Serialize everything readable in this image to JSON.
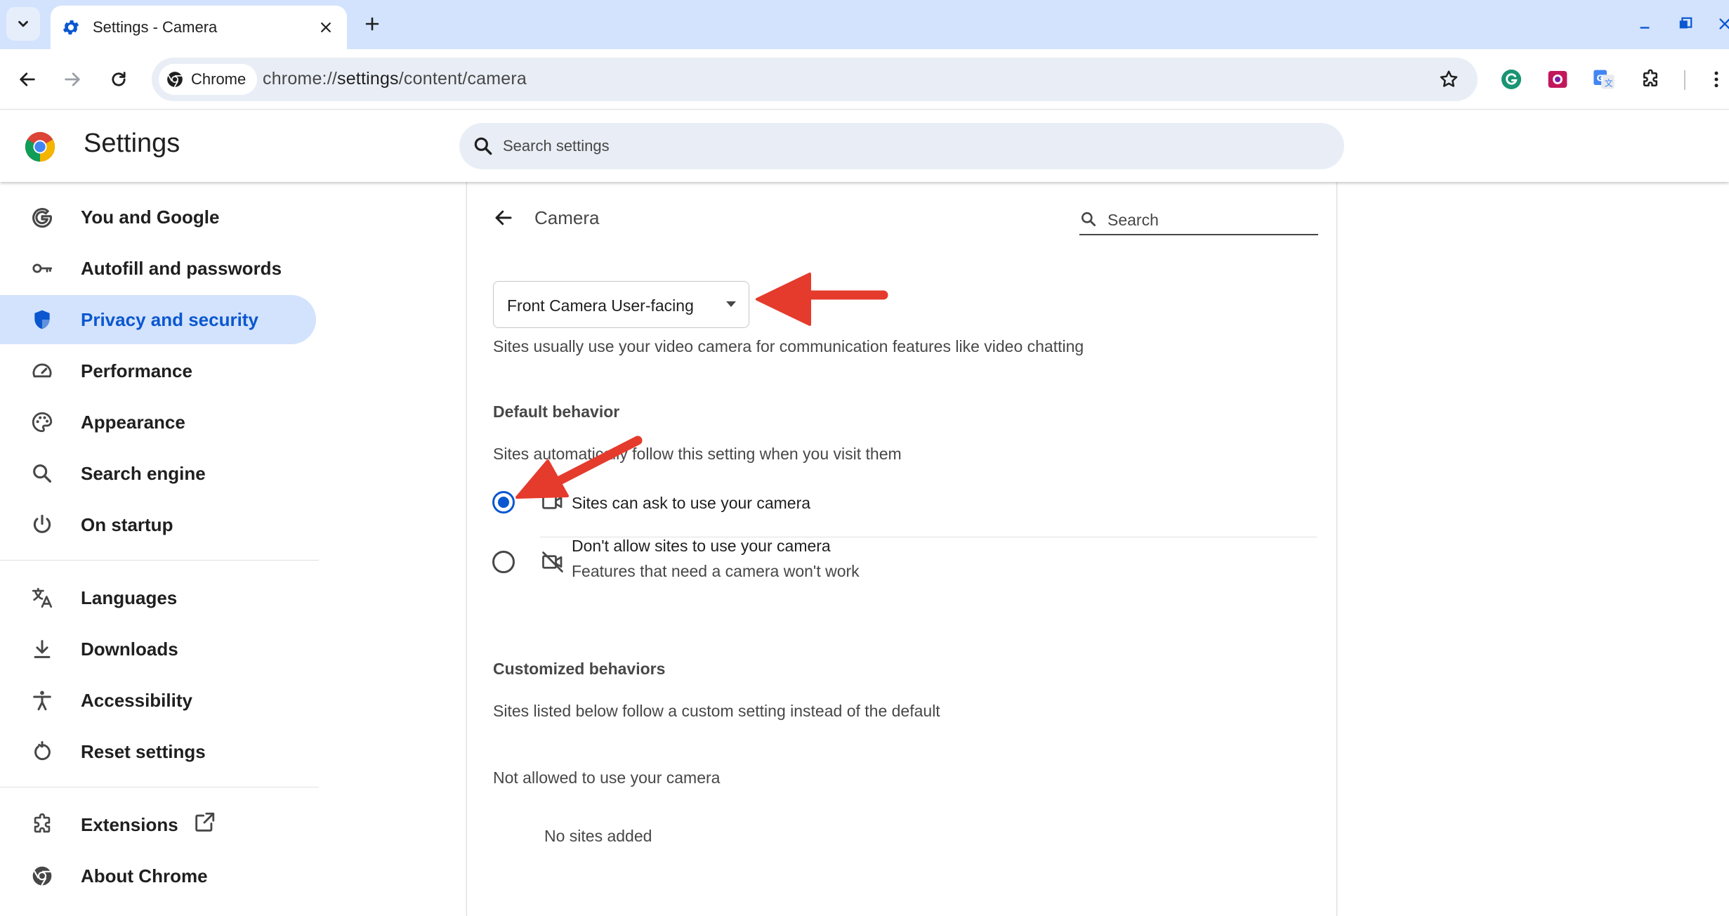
{
  "browser": {
    "tab": {
      "title": "Settings - Camera",
      "icon": "gear-icon"
    },
    "chip_label": "Chrome",
    "url": {
      "scheme": "chrome://",
      "host": "settings",
      "path": "/content/camera"
    }
  },
  "header": {
    "title": "Settings",
    "search_placeholder": "Search settings"
  },
  "sidebar": {
    "items": [
      {
        "label": "You and Google",
        "icon": "google-g-icon"
      },
      {
        "label": "Autofill and passwords",
        "icon": "key-icon"
      },
      {
        "label": "Privacy and security",
        "icon": "shield-icon",
        "active": true
      },
      {
        "label": "Performance",
        "icon": "speedometer-icon"
      },
      {
        "label": "Appearance",
        "icon": "palette-icon"
      },
      {
        "label": "Search engine",
        "icon": "search-icon"
      },
      {
        "label": "On startup",
        "icon": "power-icon"
      },
      {
        "label": "Languages",
        "icon": "translate-icon"
      },
      {
        "label": "Downloads",
        "icon": "download-icon"
      },
      {
        "label": "Accessibility",
        "icon": "accessibility-icon"
      },
      {
        "label": "Reset settings",
        "icon": "reset-icon"
      },
      {
        "label": "Extensions",
        "icon": "puzzle-icon"
      },
      {
        "label": "About Chrome",
        "icon": "chrome-icon"
      }
    ]
  },
  "content": {
    "title": "Camera",
    "search_placeholder": "Search",
    "camera_select": {
      "value": "Front Camera User-facing"
    },
    "description": "Sites usually use your video camera for communication features like video chatting",
    "default_behavior": {
      "heading": "Default behavior",
      "subtitle": "Sites automatically follow this setting when you visit them",
      "options": [
        {
          "label": "Sites can ask to use your camera",
          "selected": true,
          "icon": "camera-icon"
        },
        {
          "label": "Don't allow sites to use your camera",
          "sublabel": "Features that need a camera won't work",
          "selected": false,
          "icon": "camera-off-icon"
        }
      ]
    },
    "customized": {
      "heading": "Customized behaviors",
      "subtitle": "Sites listed below follow a custom setting instead of the default",
      "not_allowed_heading": "Not allowed to use your camera",
      "empty_text": "No sites added"
    }
  },
  "colors": {
    "accent": "#0b57d0",
    "active_bg": "#d3e3fd",
    "annotation_arrow": "#e53b2c"
  }
}
